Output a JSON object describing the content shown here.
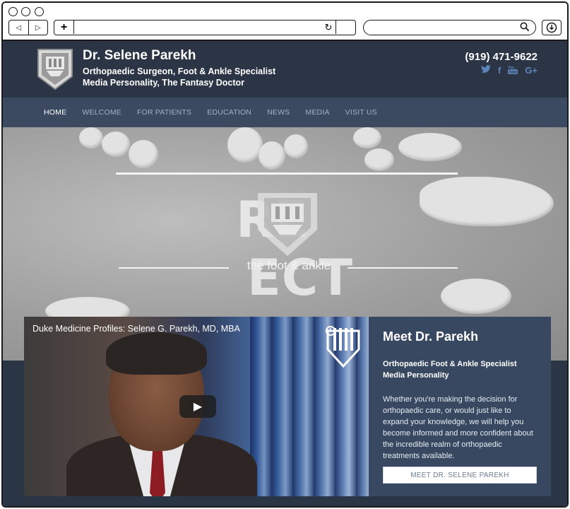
{
  "browser": {
    "back_glyph": "◁",
    "forward_glyph": "▷",
    "new_tab_glyph": "+",
    "reload_glyph": "↻",
    "search_placeholder": ""
  },
  "header": {
    "name": "Dr. Selene Parekh",
    "subtitle1": "Orthopaedic Surgeon, Foot & Ankle Specialist",
    "subtitle2": "Media Personality, The Fantasy Doctor",
    "phone": "(919) 471-9622",
    "social": [
      {
        "icon": "twitter-icon",
        "glyph": "🐦"
      },
      {
        "icon": "facebook-icon",
        "glyph": "f"
      },
      {
        "icon": "youtube-icon",
        "glyph": "▶"
      },
      {
        "icon": "google-plus-icon",
        "glyph": "G+"
      }
    ]
  },
  "nav": {
    "items": [
      "HOME",
      "WELCOME",
      "FOR PATIENTS",
      "EDUCATION",
      "NEWS",
      "MEDIA",
      "VISIT US"
    ],
    "active": "HOME"
  },
  "hero": {
    "word_left": "RE",
    "word_right": "ECT",
    "tagline": "the foot & ankle"
  },
  "video": {
    "title": "Duke Medicine Profiles: Selene G. Parekh, MD, MBA",
    "play_glyph": "▶"
  },
  "meet": {
    "heading": "Meet Dr. Parekh",
    "spec_line1": "Orthopaedic Foot & Ankle Specialist",
    "spec_line2": "Media Personality",
    "description": "Whether you're making the decision for orthopaedic care, or would just like to expand your knowledge, we will help you become informed and more confident about the incredible realm of orthopaedic treatments available.",
    "button": "MEET DR. SELENE PAREKH"
  },
  "colors": {
    "header_bg": "#2b3546",
    "nav_bg": "#3b4a60",
    "nav_text": "#9fb1c8",
    "social": "#5d84b8",
    "meet_bg": "#384860"
  }
}
